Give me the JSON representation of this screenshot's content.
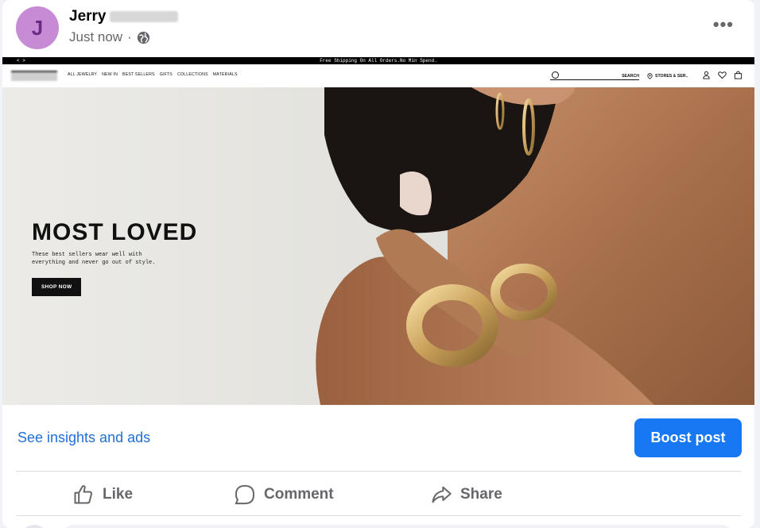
{
  "post": {
    "author_initial": "J",
    "author_name": "Jerry",
    "time": "Just now",
    "separator": "·",
    "more_label": "•••",
    "privacy_icon": "globe-icon"
  },
  "website": {
    "promo_bar": "Free Shipping On All Orders.No Min Spend.",
    "promo_arrows": "< >",
    "nav_links": [
      "ALL JEWELRY",
      "NEW IN",
      "BEST SELLERS",
      "GIFTS",
      "COLLECTIONS",
      "MATERIALS"
    ],
    "search_label": "SEARCH",
    "stores_label": "STORES & SER..",
    "hero": {
      "title": "MOST LOVED",
      "subtitle": "These best sellers wear well with everything and never go out of style.",
      "cta": "SHOP NOW"
    }
  },
  "actions": {
    "insights_link": "See insights and ads",
    "boost_button": "Boost post",
    "like": "Like",
    "comment": "Comment",
    "share": "Share"
  },
  "colors": {
    "accent": "#1877f2",
    "link": "#216fdb",
    "avatar": "#c78bd6"
  }
}
